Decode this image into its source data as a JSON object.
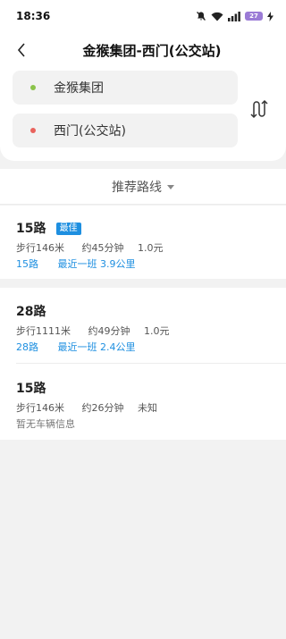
{
  "status_bar": {
    "time": "18:36",
    "battery": "27",
    "icons": [
      "mute-bell-icon",
      "wifi-icon",
      "signal-icon",
      "battery-icon",
      "charging-icon"
    ]
  },
  "header": {
    "title": "金猴集团-西门(公交站)",
    "from_stop": "金猴集团",
    "to_stop": "西门(公交站)",
    "from_color": "#8bc34a",
    "to_color": "#e9635d"
  },
  "sort": {
    "label": "推荐路线"
  },
  "routes": [
    {
      "name": "15路",
      "badge": "最佳",
      "walk": "步行146米",
      "duration": "约45分钟",
      "price": "1.0元",
      "live_bus": "15路",
      "live_info": "最近一班 3.9公里"
    },
    {
      "name": "28路",
      "walk": "步行1111米",
      "duration": "约49分钟",
      "price": "1.0元",
      "live_bus": "28路",
      "live_info": "最近一班 2.4公里"
    },
    {
      "name": "15路",
      "walk": "步行146米",
      "duration": "约26分钟",
      "price": "未知",
      "live_info": "暂无车辆信息"
    }
  ],
  "colors": {
    "accent": "#1e8fe0",
    "background": "#f2f2f2"
  }
}
